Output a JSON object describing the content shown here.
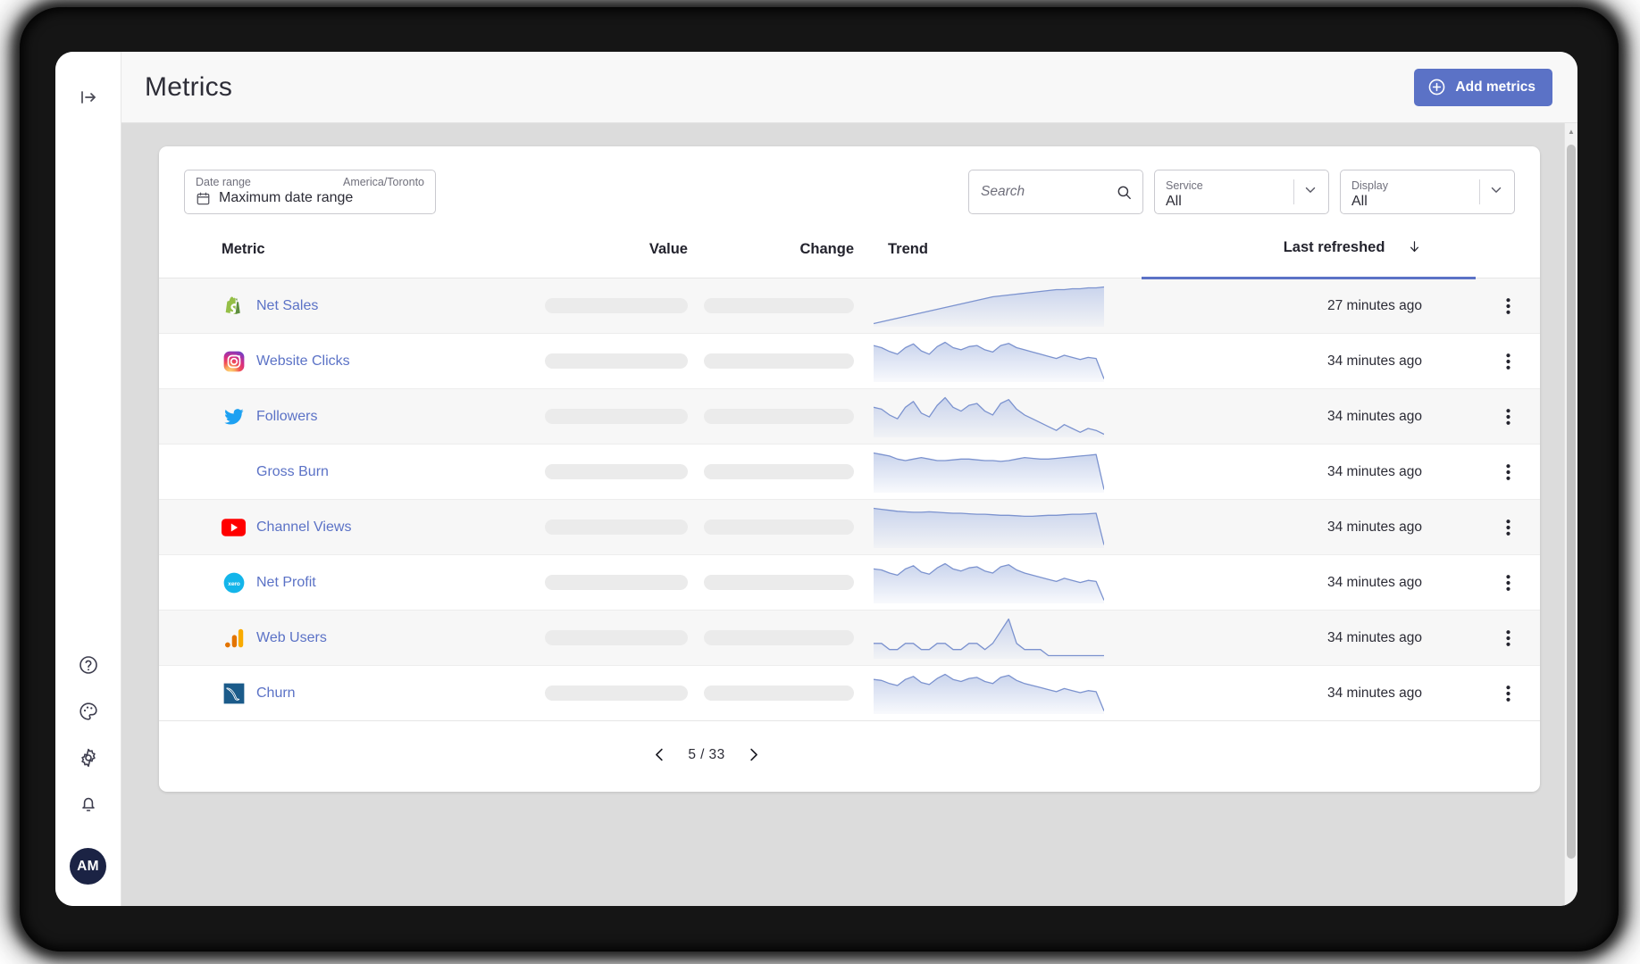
{
  "window": {
    "rail": {
      "toggle_icon": "panel-expand-icon",
      "bottom_items": [
        {
          "icon": "help-circle-icon",
          "name": "help"
        },
        {
          "icon": "palette-icon",
          "name": "appearance"
        },
        {
          "icon": "gear-icon",
          "name": "settings"
        },
        {
          "icon": "bell-icon",
          "name": "notifications"
        }
      ],
      "avatar_initials": "AM"
    },
    "topbar": {
      "title": "Metrics",
      "add_button_label": "Add metrics",
      "add_button_icon": "plus-circle-icon",
      "accent_color": "#5b72c6"
    }
  },
  "filters": {
    "date_range": {
      "label": "Date range",
      "timezone": "America/Toronto",
      "value": "Maximum date range",
      "icon": "calendar-icon"
    },
    "search": {
      "placeholder": "Search",
      "value": "",
      "icon": "search-icon"
    },
    "service": {
      "label": "Service",
      "value": "All"
    },
    "display": {
      "label": "Display",
      "value": "All"
    }
  },
  "table": {
    "columns": [
      {
        "key": "metric",
        "label": "Metric",
        "sorted": false
      },
      {
        "key": "value",
        "label": "Value",
        "sorted": false
      },
      {
        "key": "change",
        "label": "Change",
        "sorted": false
      },
      {
        "key": "trend",
        "label": "Trend",
        "sorted": false
      },
      {
        "key": "refresh",
        "label": "Last refreshed",
        "sorted": true,
        "sort_icon": "arrow-down-icon"
      }
    ],
    "rows": [
      {
        "name": "Net Sales",
        "icon": "shopify-icon",
        "value": "",
        "change": "",
        "last_refreshed": "27 minutes ago",
        "menu_icon": "kebab-menu-icon"
      },
      {
        "name": "Website Clicks",
        "icon": "instagram-icon",
        "value": "",
        "change": "",
        "last_refreshed": "34 minutes ago",
        "menu_icon": "kebab-menu-icon"
      },
      {
        "name": "Followers",
        "icon": "twitter-icon",
        "value": "",
        "change": "",
        "last_refreshed": "34 minutes ago",
        "menu_icon": "kebab-menu-icon"
      },
      {
        "name": "Gross Burn",
        "icon": "none",
        "value": "",
        "change": "",
        "last_refreshed": "34 minutes ago",
        "menu_icon": "kebab-menu-icon"
      },
      {
        "name": "Channel Views",
        "icon": "youtube-icon",
        "value": "",
        "change": "",
        "last_refreshed": "34 minutes ago",
        "menu_icon": "kebab-menu-icon"
      },
      {
        "name": "Net Profit",
        "icon": "xero-icon",
        "value": "",
        "change": "",
        "last_refreshed": "34 minutes ago",
        "menu_icon": "kebab-menu-icon"
      },
      {
        "name": "Web Users",
        "icon": "google-analytics-icon",
        "value": "",
        "change": "",
        "last_refreshed": "34 minutes ago",
        "menu_icon": "kebab-menu-icon"
      },
      {
        "name": "Churn",
        "icon": "mysql-icon",
        "value": "",
        "change": "",
        "last_refreshed": "34 minutes ago",
        "menu_icon": "kebab-menu-icon"
      }
    ]
  },
  "chart_data": {
    "type": "area",
    "title": "Trend sparklines",
    "xlabel": "",
    "ylabel": "",
    "grid": false,
    "legend": "none",
    "line_color": "#7c93cf",
    "fill_color": "#c7d2ec",
    "series": [
      {
        "name": "Net Sales",
        "values": [
          52,
          54,
          56,
          58,
          60,
          62,
          64,
          66,
          68,
          70,
          72,
          74,
          76,
          78,
          80,
          82,
          83,
          84,
          85,
          86,
          87,
          88,
          89,
          90,
          90,
          91,
          91,
          92,
          92,
          93
        ]
      },
      {
        "name": "Website Clicks",
        "values": [
          74,
          70,
          63,
          58,
          70,
          77,
          64,
          58,
          72,
          80,
          70,
          66,
          72,
          74,
          66,
          62,
          74,
          78,
          70,
          66,
          62,
          58,
          54,
          50,
          56,
          52,
          48,
          52,
          50,
          12
        ]
      },
      {
        "name": "Followers",
        "values": [
          68,
          66,
          60,
          56,
          68,
          74,
          62,
          58,
          70,
          78,
          68,
          64,
          70,
          72,
          64,
          60,
          72,
          76,
          66,
          60,
          56,
          52,
          48,
          44,
          50,
          46,
          42,
          46,
          44,
          40
        ]
      },
      {
        "name": "Gross Burn",
        "values": [
          88,
          86,
          84,
          80,
          78,
          80,
          82,
          80,
          78,
          78,
          79,
          80,
          80,
          79,
          78,
          78,
          77,
          78,
          80,
          82,
          81,
          80,
          80,
          81,
          82,
          83,
          84,
          85,
          86,
          40
        ]
      },
      {
        "name": "Channel Views",
        "values": [
          92,
          90,
          88,
          86,
          85,
          84,
          84,
          85,
          84,
          83,
          82,
          82,
          81,
          80,
          80,
          79,
          78,
          78,
          77,
          76,
          76,
          77,
          78,
          78,
          79,
          80,
          80,
          81,
          82,
          18
        ]
      },
      {
        "name": "Net Profit",
        "values": [
          70,
          68,
          62,
          58,
          70,
          76,
          64,
          60,
          72,
          80,
          70,
          66,
          72,
          74,
          66,
          62,
          74,
          78,
          68,
          62,
          58,
          54,
          50,
          46,
          52,
          48,
          44,
          48,
          46,
          10
        ]
      },
      {
        "name": "Web Users",
        "values": [
          84,
          84,
          83,
          83,
          84,
          84,
          83,
          83,
          84,
          84,
          83,
          83,
          84,
          84,
          83,
          84,
          86,
          88,
          84,
          83,
          83,
          83,
          82,
          82,
          82,
          82,
          82,
          82,
          82,
          82
        ]
      },
      {
        "name": "Churn",
        "values": [
          72,
          70,
          64,
          60,
          72,
          78,
          66,
          62,
          74,
          82,
          72,
          68,
          74,
          76,
          68,
          64,
          76,
          80,
          70,
          64,
          60,
          56,
          52,
          48,
          54,
          50,
          46,
          50,
          48,
          10
        ]
      }
    ]
  },
  "pagination": {
    "prev_icon": "chevron-left-icon",
    "next_icon": "chevron-right-icon",
    "label": "5 / 33",
    "current_page": 5,
    "total_pages": 33
  }
}
